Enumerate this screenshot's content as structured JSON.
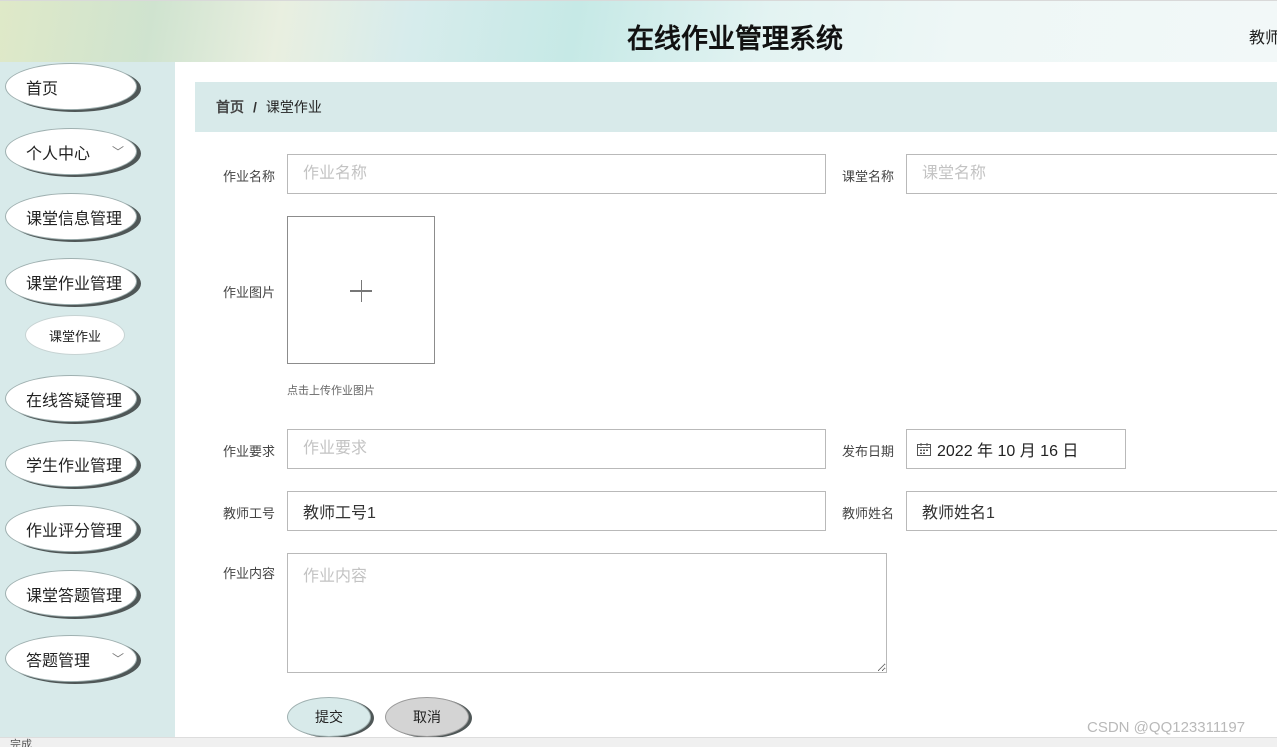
{
  "header": {
    "title": "在线作业管理系统",
    "user": "教师"
  },
  "sidebar": {
    "items": [
      {
        "label": "首页"
      },
      {
        "label": "个人中心",
        "chevron": "chevron-down-icon"
      },
      {
        "label": "课堂信息管理"
      },
      {
        "label": "课堂作业管理"
      },
      {
        "label": "在线答疑管理"
      },
      {
        "label": "学生作业管理"
      },
      {
        "label": "作业评分管理"
      },
      {
        "label": "课堂答题管理"
      },
      {
        "label": "答题管理",
        "chevron": "chevron-down-icon"
      }
    ],
    "sub_item": "课堂作业"
  },
  "breadcrumb": {
    "home": "首页",
    "separator": "/",
    "current": "课堂作业"
  },
  "form": {
    "homework_name": {
      "label": "作业名称",
      "placeholder": "作业名称"
    },
    "course_name": {
      "label": "课堂名称",
      "placeholder": "课堂名称"
    },
    "homework_image": {
      "label": "作业图片",
      "tip": "点击上传作业图片"
    },
    "requirement": {
      "label": "作业要求",
      "placeholder": "作业要求"
    },
    "publish_date": {
      "label": "发布日期",
      "value": "2022 年 10 月 16 日"
    },
    "teacher_id": {
      "label": "教师工号",
      "value": "教师工号1"
    },
    "teacher_name": {
      "label": "教师姓名",
      "value": "教师姓名1"
    },
    "content": {
      "label": "作业内容",
      "placeholder": "作业内容"
    },
    "submit_label": "提交",
    "cancel_label": "取消"
  },
  "watermark": "CSDN @QQ123311197",
  "statusbar": "完成",
  "colors": {
    "sidebar_bg": "#d8eaea",
    "breadcrumb_bg": "#d8eaea",
    "submit_bg": "#d8eaea",
    "cancel_bg": "#d4d4d4"
  }
}
